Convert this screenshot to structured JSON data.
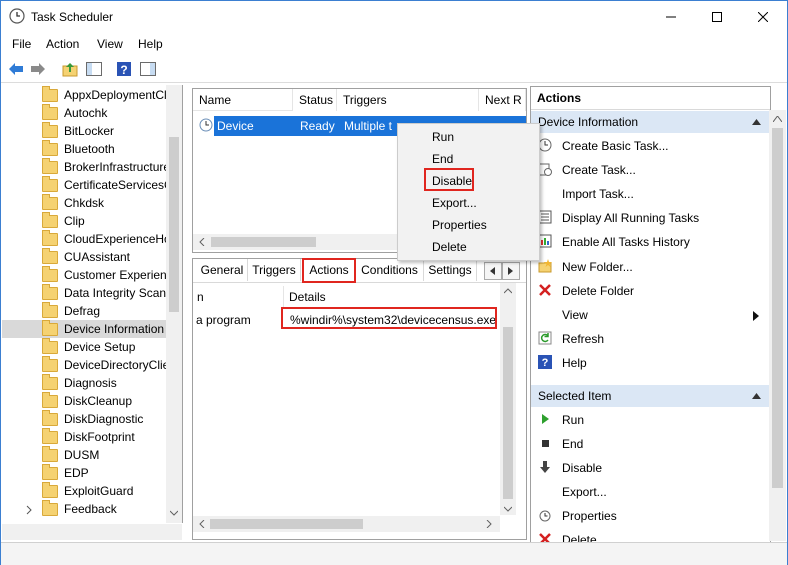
{
  "window": {
    "title": "Task Scheduler"
  },
  "menu": [
    "File",
    "Action",
    "View",
    "Help"
  ],
  "tree": [
    "AppxDeploymentCl",
    "Autochk",
    "BitLocker",
    "Bluetooth",
    "BrokerInfrastructure",
    "CertificateServicesC",
    "Chkdsk",
    "Clip",
    "CloudExperienceHo",
    "CUAssistant",
    "Customer Experienc",
    "Data Integrity Scan",
    "Defrag",
    "Device Information",
    "Device Setup",
    "DeviceDirectoryClie",
    "Diagnosis",
    "DiskCleanup",
    "DiskDiagnostic",
    "DiskFootprint",
    "DUSM",
    "EDP",
    "ExploitGuard",
    "Feedback"
  ],
  "tree_selected": "Device Information",
  "task_list": {
    "columns": [
      "Name",
      "Status",
      "Triggers",
      "Next R"
    ],
    "row": {
      "name": "Device",
      "status": "Ready",
      "triggers": "Multiple t"
    }
  },
  "context_menu": [
    "Run",
    "End",
    "Disable",
    "Export...",
    "Properties",
    "Delete"
  ],
  "tabs": [
    "General",
    "Triggers",
    "Actions",
    "Conditions",
    "Settings"
  ],
  "actions_table": {
    "columns": [
      "n",
      "Details"
    ],
    "row": {
      "action": "a program",
      "details": "%windir%\\system32\\devicecensus.exe"
    }
  },
  "actions_panel": {
    "header": "Actions",
    "group1": "Device Information",
    "items1": [
      "Create Basic Task...",
      "Create Task...",
      "Import Task...",
      "Display All Running Tasks",
      "Enable All Tasks History",
      "New Folder...",
      "Delete Folder",
      "View",
      "Refresh",
      "Help"
    ],
    "group2": "Selected Item",
    "items2": [
      "Run",
      "End",
      "Disable",
      "Export...",
      "Properties",
      "Delete"
    ]
  }
}
